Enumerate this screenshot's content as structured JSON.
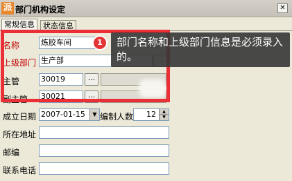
{
  "window": {
    "app_icon_glyph": "派",
    "title": "部门机构设定",
    "close_glyph": "✕"
  },
  "tabs": [
    {
      "label": "常规信息",
      "active": true
    },
    {
      "label": "状态信息",
      "active": false
    }
  ],
  "form": {
    "name_label": "名称",
    "name_value": "炼胶车间",
    "parent_label": "上级部门",
    "parent_value": "生产部",
    "manager_label": "主管",
    "manager_value": "30019",
    "deputy_label": "副主管",
    "deputy_value": "30021",
    "ellipsis": "...",
    "established_label": "成立日期",
    "established_value": "2007-01-15",
    "headcount_label": "编制人数",
    "headcount_value": "12",
    "address_label": "所在地址",
    "address_value": "",
    "postcode_label": "邮编",
    "postcode_value": "",
    "phone_label": "联系电话",
    "phone_value": ""
  },
  "tooltip": {
    "step": "1",
    "text": "部门名称和上级部门信息是必须录入的。"
  },
  "colors": {
    "highlight": "#ea2f37",
    "required_label": "#c00000",
    "tooltip_bg": "#363636"
  }
}
